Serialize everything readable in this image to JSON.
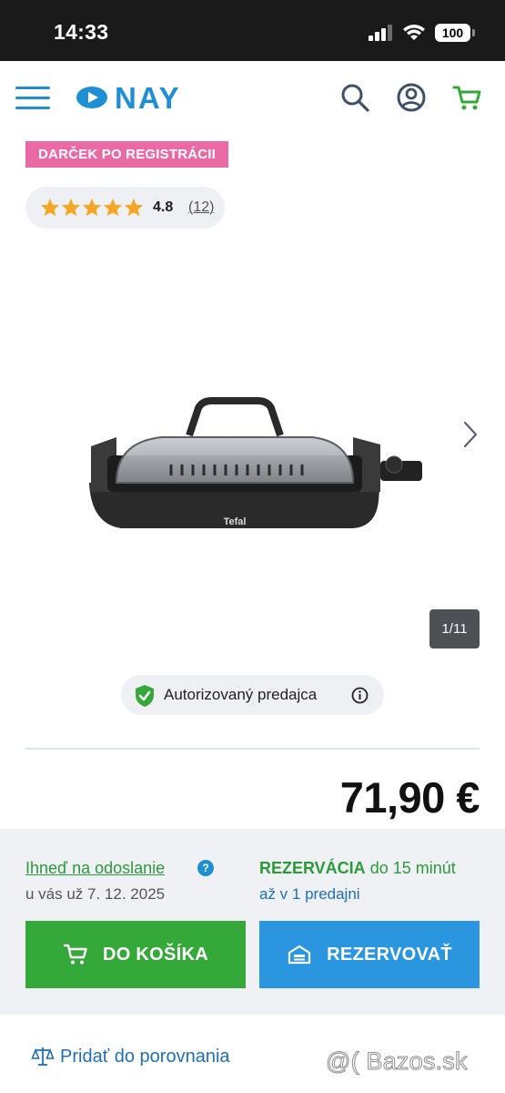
{
  "status_bar": {
    "time": "14:33",
    "battery": "100"
  },
  "header": {
    "logo_text": "NAY",
    "accent_color": "#1f8fd4",
    "cart_color": "#35a83a",
    "icons": [
      "menu-icon",
      "search-icon",
      "account-icon",
      "cart-icon"
    ]
  },
  "promo": {
    "badge": "DARČEK PO REGISTRÁCII",
    "color": "#e96aa5"
  },
  "rating": {
    "value": "4.8",
    "count": "12",
    "stars": 5,
    "star_color": "#f5a623"
  },
  "gallery": {
    "counter": "1/11",
    "product_brand_on_image": "Tefal"
  },
  "authorized": {
    "label": "Autorizovaný predajca"
  },
  "price": "71,90 €",
  "availability": {
    "shipping_link": "Ihneď na odoslanie",
    "shipping_date": "u vás už 7. 12. 2025",
    "reserve_bold": "REZERVÁCIA",
    "reserve_rest": " do 15 minút",
    "reserve_store": "až v 1 predajni"
  },
  "buttons": {
    "add_to_cart": "DO KOŠÍKA",
    "reserve": "REZERVOVAŤ"
  },
  "compare": {
    "label": "Pridať do porovnania"
  },
  "watermark": "@( Bazos.sk"
}
